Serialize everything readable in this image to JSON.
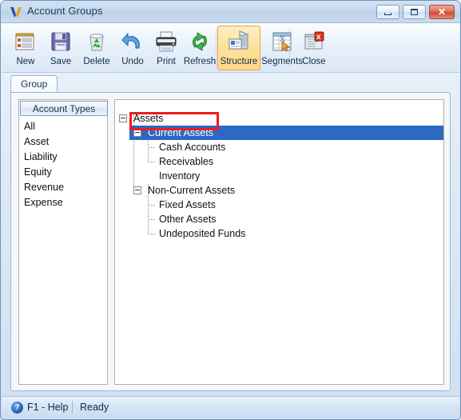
{
  "window": {
    "title": "Account Groups",
    "logo_icon": "v-logo-icon",
    "controls": {
      "minimize": {
        "icon": "minimize-icon",
        "label": ""
      },
      "maximize": {
        "icon": "restore-icon",
        "label": ""
      },
      "close": {
        "icon": "close-icon",
        "label": "✕"
      }
    }
  },
  "toolbar": {
    "buttons": [
      {
        "label": "New",
        "icon": "new-document-icon",
        "active": false
      },
      {
        "label": "Save",
        "icon": "floppy-disk-icon",
        "active": false
      },
      {
        "label": "Delete",
        "icon": "recycle-bin-icon",
        "active": false
      },
      {
        "label": "Undo",
        "icon": "undo-arrow-icon",
        "active": false
      },
      {
        "label": "Print",
        "icon": "printer-icon",
        "active": false
      },
      {
        "label": "Refresh",
        "icon": "refresh-icon",
        "active": false
      },
      {
        "label": "Structure",
        "icon": "structure-icon",
        "active": true
      },
      {
        "label": "Segments",
        "icon": "segments-icon",
        "active": false
      },
      {
        "label": "Close",
        "icon": "close-window-icon",
        "active": false
      }
    ]
  },
  "tabs": [
    {
      "label": "Group",
      "selected": true
    }
  ],
  "account_types": {
    "header": "Account Types",
    "items": [
      {
        "label": "All"
      },
      {
        "label": "Asset"
      },
      {
        "label": "Liability"
      },
      {
        "label": "Equity"
      },
      {
        "label": "Revenue"
      },
      {
        "label": "Expense"
      }
    ]
  },
  "tree": {
    "nodes": [
      {
        "label": "Assets",
        "level": 0,
        "expander": "collapse-icon",
        "selected": false
      },
      {
        "label": "Current Assets",
        "level": 1,
        "expander": "collapse-icon",
        "selected": true
      },
      {
        "label": "Cash Accounts",
        "level": 2,
        "expander": "none",
        "selected": false
      },
      {
        "label": "Receivables",
        "level": 2,
        "expander": "none",
        "selected": false
      },
      {
        "label": "Inventory",
        "level": 2,
        "expander": "none",
        "selected": false
      },
      {
        "label": "Non-Current Assets",
        "level": 1,
        "expander": "collapse-icon",
        "selected": false
      },
      {
        "label": "Fixed Assets",
        "level": 2,
        "expander": "none",
        "selected": false
      },
      {
        "label": "Other Assets",
        "level": 2,
        "expander": "none",
        "selected": false
      },
      {
        "label": "Undeposited Funds",
        "level": 2,
        "expander": "none",
        "selected": false
      }
    ],
    "highlight_color": "#2d68c4",
    "annotation_color": "#ee1c1c"
  },
  "statusbar": {
    "help_icon": "help-icon",
    "help_label": "F1 - Help",
    "status_label": "Ready"
  }
}
